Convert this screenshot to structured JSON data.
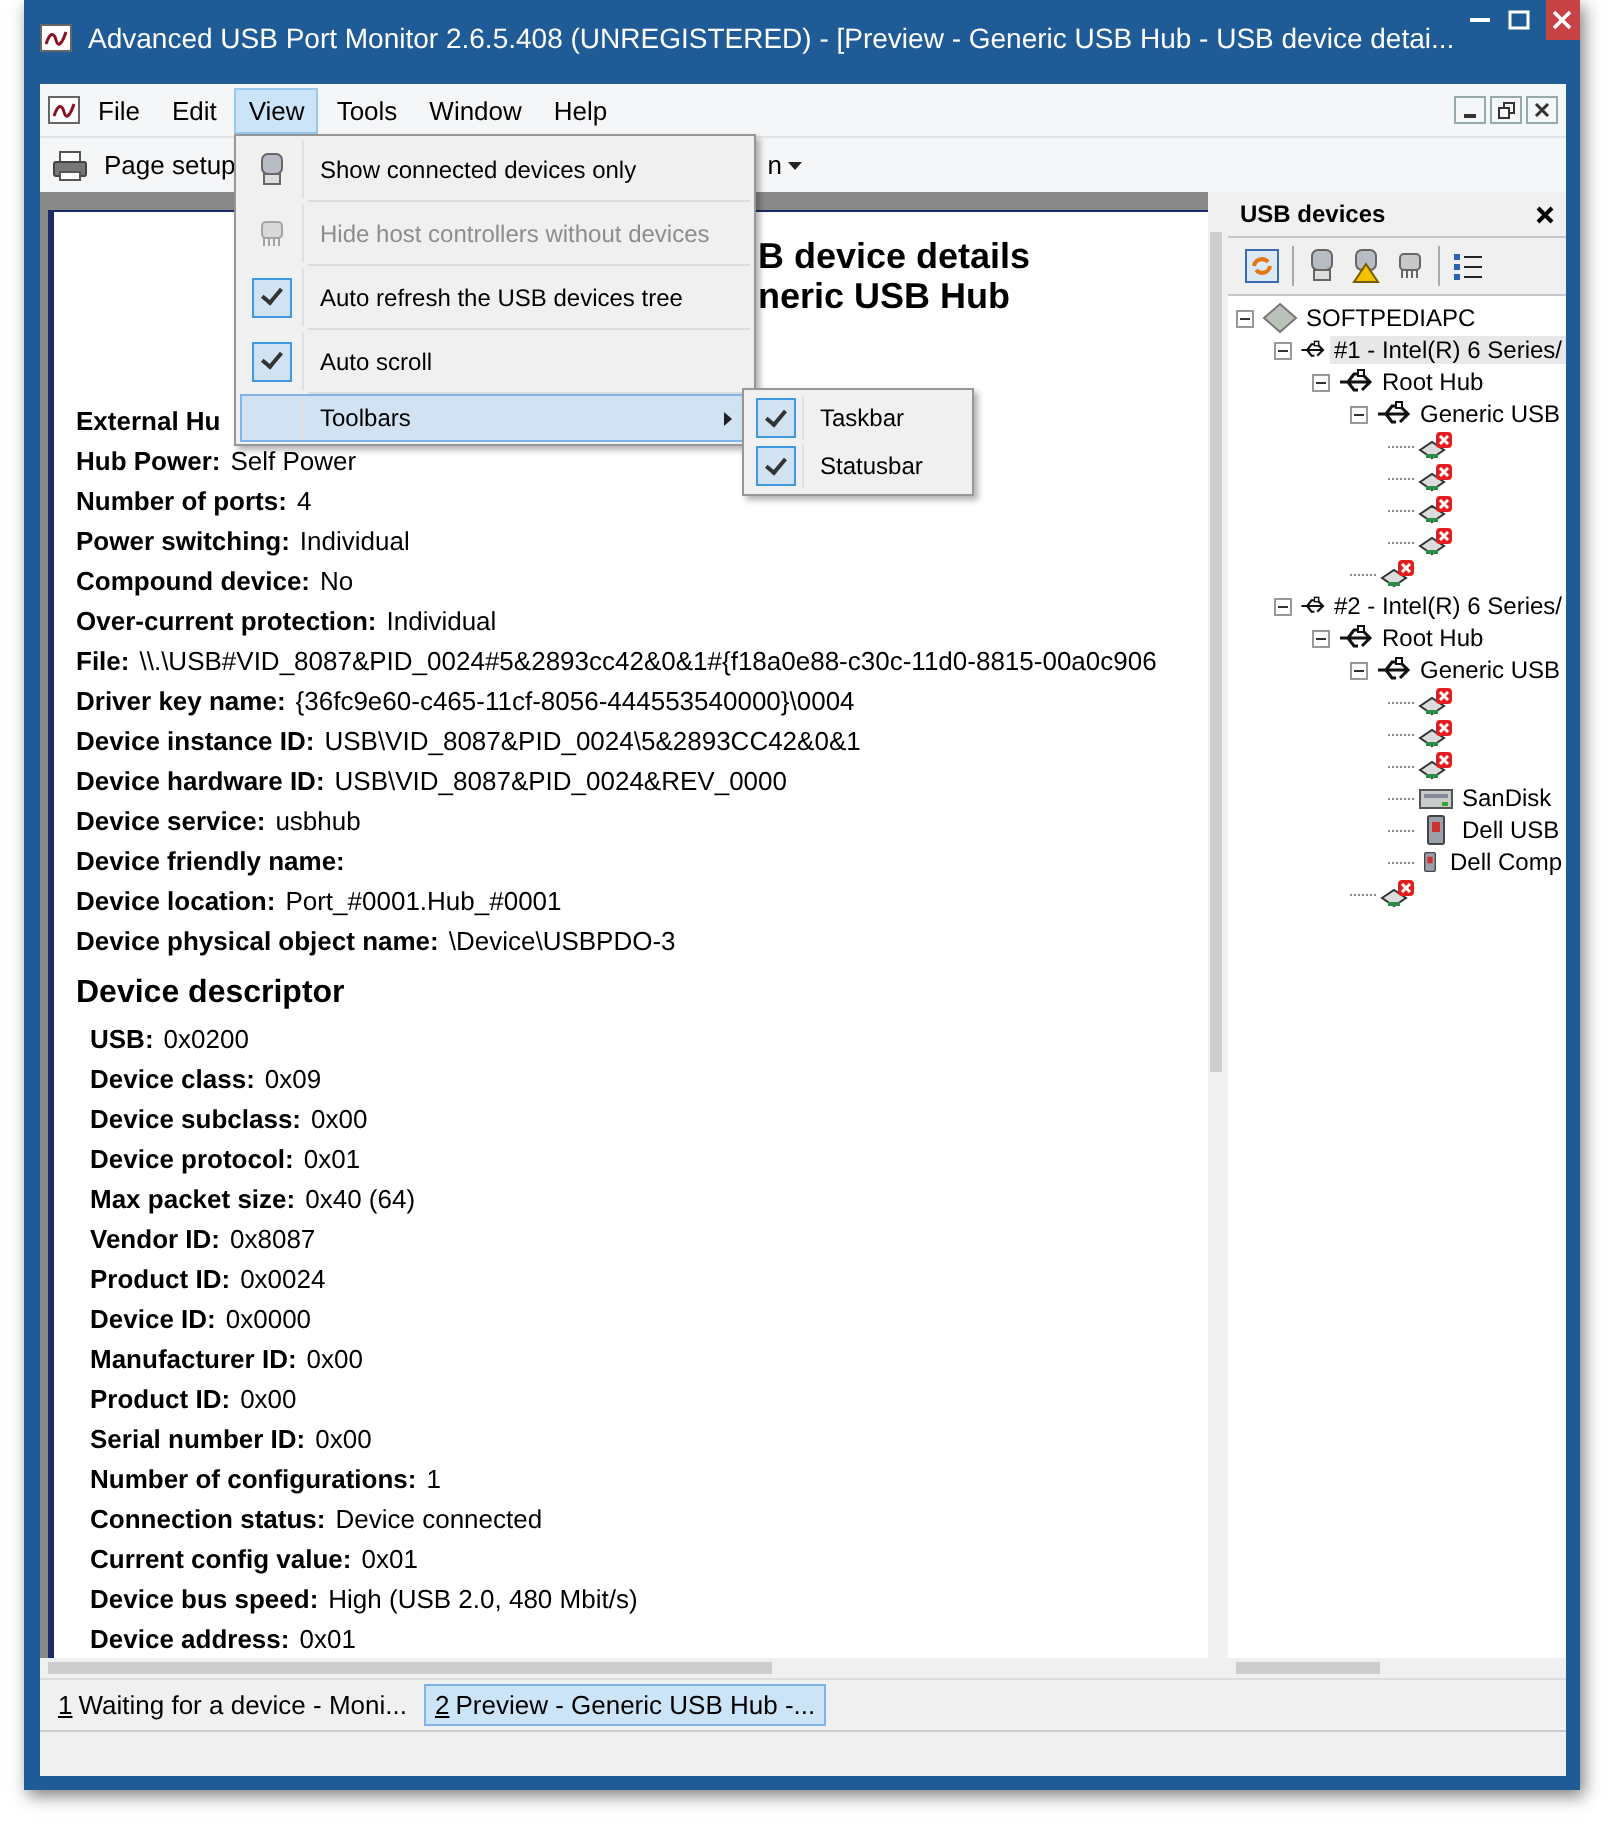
{
  "window": {
    "title": "Advanced USB Port Monitor 2.6.5.408 (UNREGISTERED) - [Preview - Generic USB Hub - USB device detai..."
  },
  "menubar": [
    {
      "label": "File",
      "selected": false
    },
    {
      "label": "Edit",
      "selected": false
    },
    {
      "label": "View",
      "selected": true
    },
    {
      "label": "Tools",
      "selected": false
    },
    {
      "label": "Window",
      "selected": false
    },
    {
      "label": "Help",
      "selected": false
    }
  ],
  "toolbar": [
    {
      "label": "Page setup",
      "dropdown": false
    },
    {
      "label": "n",
      "dropdown": true
    }
  ],
  "view_menu": [
    {
      "label": "Show connected devices only",
      "kind": "icon",
      "disabled": false,
      "highlighted": false
    },
    {
      "label": "Hide host controllers without devices",
      "kind": "icon",
      "disabled": true,
      "highlighted": false
    },
    {
      "label": "Auto refresh the USB devices tree",
      "kind": "check",
      "checked": true,
      "highlighted": false
    },
    {
      "label": "Auto scroll",
      "kind": "check",
      "checked": true,
      "highlighted": false
    },
    {
      "label": "Toolbars",
      "kind": "submenu",
      "highlighted": true
    }
  ],
  "toolbars_submenu": [
    {
      "label": "Taskbar",
      "checked": true
    },
    {
      "label": "Statusbar",
      "checked": true
    }
  ],
  "document": {
    "heading": [
      "B device details",
      "neric USB Hub"
    ],
    "properties": [
      {
        "label": "External Hu"
      },
      {
        "label": "Hub Power:",
        "value": "Self Power"
      },
      {
        "label": "Number of ports:",
        "value": "4"
      },
      {
        "label": "Power switching:",
        "value": "Individual"
      },
      {
        "label": "Compound device:",
        "value": "No"
      },
      {
        "label": "Over-current protection:",
        "value": "Individual"
      },
      {
        "label": "File:",
        "value": "\\\\.\\USB#VID_8087&PID_0024#5&2893cc42&0&1#{f18a0e88-c30c-11d0-8815-00a0c906"
      },
      {
        "label": "Driver key name:",
        "value": "{36fc9e60-c465-11cf-8056-444553540000}\\0004"
      },
      {
        "label": "Device instance ID:",
        "value": "USB\\VID_8087&PID_0024\\5&2893CC42&0&1"
      },
      {
        "label": "Device hardware ID:",
        "value": "USB\\VID_8087&PID_0024&REV_0000"
      },
      {
        "label": "Device service:",
        "value": "usbhub"
      },
      {
        "label": "Device friendly name:"
      },
      {
        "label": "Device location:",
        "value": "Port_#0001.Hub_#0001"
      },
      {
        "label": "Device physical object name:",
        "value": "\\Device\\USBPDO-3"
      }
    ],
    "section_title": "Device descriptor",
    "descriptor": [
      {
        "label": "USB:",
        "value": "0x0200"
      },
      {
        "label": "Device class:",
        "value": "0x09"
      },
      {
        "label": "Device subclass:",
        "value": "0x00"
      },
      {
        "label": "Device protocol:",
        "value": "0x01"
      },
      {
        "label": "Max packet size:",
        "value": "0x40 (64)"
      },
      {
        "label": "Vendor ID:",
        "value": "0x8087"
      },
      {
        "label": "Product ID:",
        "value": "0x0024"
      },
      {
        "label": "Device ID:",
        "value": "0x0000"
      },
      {
        "label": "Manufacturer ID:",
        "value": "0x00"
      },
      {
        "label": "Product ID:",
        "value": "0x00"
      },
      {
        "label": "Serial number ID:",
        "value": "0x00"
      },
      {
        "label": "Number of configurations:",
        "value": "1"
      },
      {
        "label": "Connection status:",
        "value": "Device connected"
      },
      {
        "label": "Current config value:",
        "value": "0x01"
      },
      {
        "label": "Device bus speed:",
        "value": "High (USB 2.0, 480 Mbit/s)"
      },
      {
        "label": "Device address:",
        "value": "0x01"
      }
    ]
  },
  "usb_devices_panel": {
    "title": "USB devices",
    "tree": [
      {
        "kind": "computer",
        "label": "SOFTPEDIAPC",
        "expanded": true,
        "children": [
          {
            "kind": "hub",
            "label": "#1 - Intel(R) 6 Series/",
            "expanded": true,
            "selected": true,
            "children": [
              {
                "kind": "hub",
                "label": "Root Hub",
                "expanded": true,
                "children": [
                  {
                    "kind": "hub",
                    "label": "Generic USB",
                    "expanded": true,
                    "children": [
                      {
                        "kind": "port"
                      },
                      {
                        "kind": "port"
                      },
                      {
                        "kind": "port"
                      },
                      {
                        "kind": "port"
                      }
                    ]
                  },
                  {
                    "kind": "port"
                  }
                ]
              }
            ]
          },
          {
            "kind": "hub",
            "label": "#2 - Intel(R) 6 Series/",
            "expanded": true,
            "selected": false,
            "children": [
              {
                "kind": "hub",
                "label": "Root Hub",
                "expanded": true,
                "children": [
                  {
                    "kind": "hub",
                    "label": "Generic USB",
                    "expanded": true,
                    "children": [
                      {
                        "kind": "port"
                      },
                      {
                        "kind": "port"
                      },
                      {
                        "kind": "port"
                      },
                      {
                        "kind": "storage",
                        "label": "SanDisk"
                      },
                      {
                        "kind": "device",
                        "label": "Dell USB"
                      },
                      {
                        "kind": "device",
                        "label": "Dell Comp"
                      }
                    ]
                  },
                  {
                    "kind": "port"
                  }
                ]
              }
            ]
          }
        ]
      }
    ]
  },
  "window_tabs": [
    {
      "number": "1",
      "label": "Waiting for a device - Moni...",
      "selected": false
    },
    {
      "number": "2",
      "label": "Preview - Generic USB Hub -...",
      "selected": true
    }
  ]
}
